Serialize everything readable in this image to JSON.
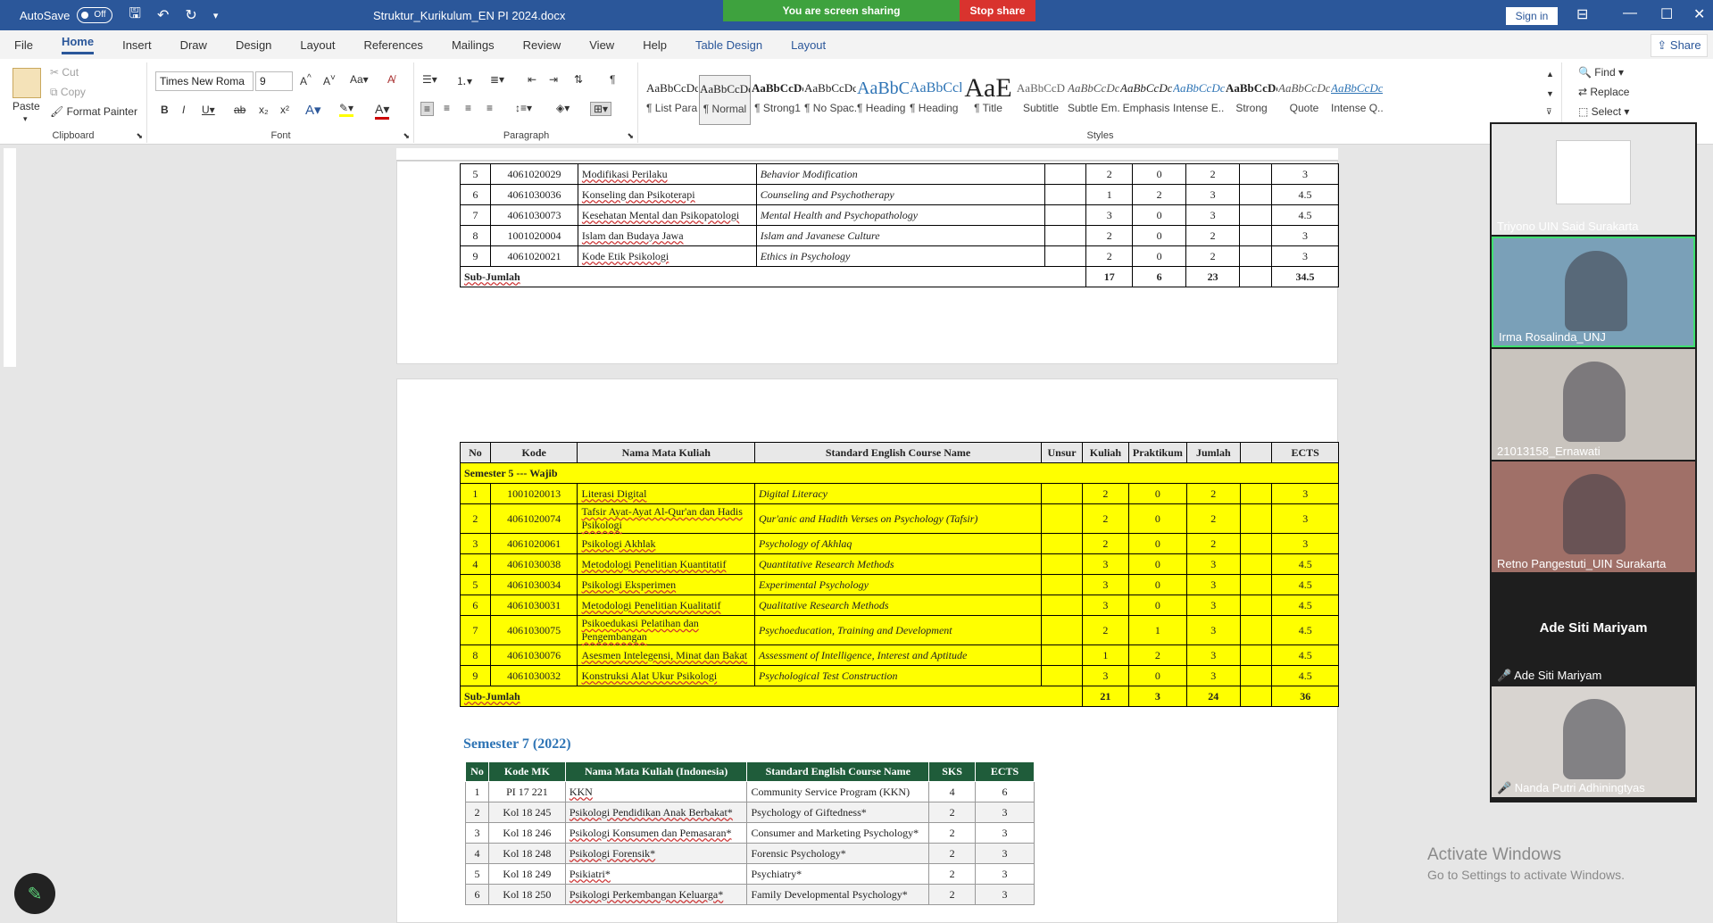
{
  "titlebar": {
    "autosave": "AutoSave",
    "autosave_state": "Off",
    "doc_title": "Struktur_Kurikulum_EN PI 2024.docx",
    "sharing_text": "You are screen sharing",
    "stop_share": "Stop share",
    "signin": "Sign in"
  },
  "menu": [
    "File",
    "Home",
    "Insert",
    "Draw",
    "Design",
    "Layout",
    "References",
    "Mailings",
    "Review",
    "View",
    "Help",
    "Table Design",
    "Layout"
  ],
  "share_label": "Share",
  "ribbon": {
    "clipboard": {
      "paste": "Paste",
      "cut": "Cut",
      "copy": "Copy",
      "format_painter": "Format Painter",
      "label": "Clipboard"
    },
    "font": {
      "name": "Times New Roma",
      "size": "9",
      "label": "Font"
    },
    "paragraph": {
      "label": "Paragraph"
    },
    "styles": {
      "label": "Styles",
      "items": [
        {
          "preview": "AaBbCcDc",
          "name": "¶ List Para..."
        },
        {
          "preview": "AaBbCcDc",
          "name": "¶ Normal"
        },
        {
          "preview": "AaBbCcDd",
          "name": "¶ Strong1"
        },
        {
          "preview": "AaBbCcDc",
          "name": "¶ No Spac..."
        },
        {
          "preview": "AaBbC",
          "name": "¶ Heading 1"
        },
        {
          "preview": "AaBbCcl",
          "name": "¶ Heading 2"
        },
        {
          "preview": "AaE",
          "name": "¶ Title"
        },
        {
          "preview": "AaBbCcD",
          "name": "Subtitle"
        },
        {
          "preview": "AaBbCcDc",
          "name": "Subtle Em..."
        },
        {
          "preview": "AaBbCcDc",
          "name": "Emphasis"
        },
        {
          "preview": "AaBbCcDc",
          "name": "Intense E..."
        },
        {
          "preview": "AaBbCcDd",
          "name": "Strong"
        },
        {
          "preview": "AaBbCcDc",
          "name": "Quote"
        },
        {
          "preview": "AaBbCcDc",
          "name": "Intense Q..."
        }
      ]
    },
    "editing": {
      "find": "Find",
      "replace": "Replace",
      "select": "Select"
    }
  },
  "page1_rows": [
    [
      "5",
      "4061020029",
      "Modifikasi Perilaku",
      "Behavior Modification",
      "",
      "2",
      "0",
      "2",
      "",
      "3"
    ],
    [
      "6",
      "4061030036",
      "Konseling dan Psikoterapi",
      "Counseling and Psychotherapy",
      "",
      "1",
      "2",
      "3",
      "",
      "4.5"
    ],
    [
      "7",
      "4061030073",
      "Kesehatan Mental dan Psikopatologi",
      "Mental Health and Psychopathology",
      "",
      "3",
      "0",
      "3",
      "",
      "4.5"
    ],
    [
      "8",
      "1001020004",
      "Islam dan Budaya Jawa",
      "Islam and Javanese Culture",
      "",
      "2",
      "0",
      "2",
      "",
      "3"
    ],
    [
      "9",
      "4061020021",
      "Kode Etik Psikologi",
      "Ethics in Psychology",
      "",
      "2",
      "0",
      "2",
      "",
      "3"
    ]
  ],
  "page1_subtotal": {
    "label": "Sub-Jumlah",
    "kuliah": "17",
    "praktikum": "6",
    "jumlah": "23",
    "ects": "34.5"
  },
  "sem5": {
    "headers": [
      "No",
      "Kode",
      "Nama Mata Kuliah",
      "Standard English Course Name",
      "Unsur",
      "Kuliah",
      "Praktikum",
      "Jumlah",
      "",
      "ECTS"
    ],
    "title": "Semester 5 --- Wajib",
    "rows": [
      [
        "1",
        "1001020013",
        "Literasi Digital",
        "Digital Literacy",
        "",
        "2",
        "0",
        "2",
        "",
        "3"
      ],
      [
        "2",
        "4061020074",
        "Tafsir Ayat-Ayat Al-Qur'an dan Hadis Psikologi",
        "Qur'anic and Hadith Verses on Psychology (Tafsir)",
        "",
        "2",
        "0",
        "2",
        "",
        "3"
      ],
      [
        "3",
        "4061020061",
        "Psikologi Akhlak",
        "Psychology of Akhlaq",
        "",
        "2",
        "0",
        "2",
        "",
        "3"
      ],
      [
        "4",
        "4061030038",
        "Metodologi Penelitian Kuantitatif",
        "Quantitative Research Methods",
        "",
        "3",
        "0",
        "3",
        "",
        "4.5"
      ],
      [
        "5",
        "4061030034",
        "Psikologi Eksperimen",
        "Experimental Psychology",
        "",
        "3",
        "0",
        "3",
        "",
        "4.5"
      ],
      [
        "6",
        "4061030031",
        "Metodologi Penelitian Kualitatif",
        "Qualitative Research Methods",
        "",
        "3",
        "0",
        "3",
        "",
        "4.5"
      ],
      [
        "7",
        "4061030075",
        "Psikoedukasi Pelatihan dan Pengembangan",
        "Psychoeducation, Training and Development",
        "",
        "2",
        "1",
        "3",
        "",
        "4.5"
      ],
      [
        "8",
        "4061030076",
        "Asesmen Intelegensi, Minat dan Bakat",
        "Assessment of Intelligence, Interest and Aptitude",
        "",
        "1",
        "2",
        "3",
        "",
        "4.5"
      ],
      [
        "9",
        "4061030032",
        "Konstruksi Alat Ukur Psikologi",
        "Psychological Test Construction",
        "",
        "3",
        "0",
        "3",
        "",
        "4.5"
      ]
    ],
    "subtotal": {
      "label": "Sub-Jumlah",
      "kuliah": "21",
      "praktikum": "3",
      "jumlah": "24",
      "ects": "36"
    }
  },
  "sem7": {
    "title": "Semester 7 (2022)",
    "headers": [
      "No",
      "Kode MK",
      "Nama Mata Kuliah (Indonesia)",
      "Standard English Course Name",
      "SKS",
      "ECTS"
    ],
    "rows": [
      [
        "1",
        "PI 17 221",
        "KKN",
        "Community Service Program (KKN)",
        "4",
        "6"
      ],
      [
        "2",
        "Kol 18 245",
        "Psikologi Pendidikan Anak Berbakat*",
        "Psychology of Giftedness*",
        "2",
        "3"
      ],
      [
        "3",
        "Kol 18 246",
        "Psikologi Konsumen dan Pemasaran*",
        "Consumer and Marketing Psychology*",
        "2",
        "3"
      ],
      [
        "4",
        "Kol 18 248",
        "Psikologi Forensik*",
        "Forensic Psychology*",
        "2",
        "3"
      ],
      [
        "5",
        "Kol 18 249",
        "Psikiatri*",
        "Psychiatry*",
        "2",
        "3"
      ],
      [
        "6",
        "Kol 18 250",
        "Psikologi Perkembangan Keluarga*",
        "Family Developmental Psychology*",
        "2",
        "3"
      ]
    ]
  },
  "participants": [
    {
      "name": "Triyono UIN Said Surakarta",
      "bg": "#e8e8e8"
    },
    {
      "name": "Irma Rosalinda_UNJ",
      "bg": "#7aa0b8"
    },
    {
      "name": "21013158_Ernawati",
      "bg": "#c9c4be"
    },
    {
      "name": "Retno Pangestuti_UIN Surakarta",
      "bg": "#a07068"
    },
    {
      "name": "Ade Siti Mariyam",
      "bg": "#1e1e1e",
      "big": "Ade Siti Mariyam"
    },
    {
      "name": "Nanda Putri Adhiningtyas",
      "bg": "#d8d4d0"
    }
  ],
  "activate": {
    "line1": "Activate Windows",
    "line2": "Go to Settings to activate Windows."
  },
  "colors": {
    "word_blue": "#2b579a",
    "highlight": "#ffff00",
    "table_green": "#1f5c3a",
    "share_green": "#3ea23e",
    "stop_red": "#d9332e"
  }
}
